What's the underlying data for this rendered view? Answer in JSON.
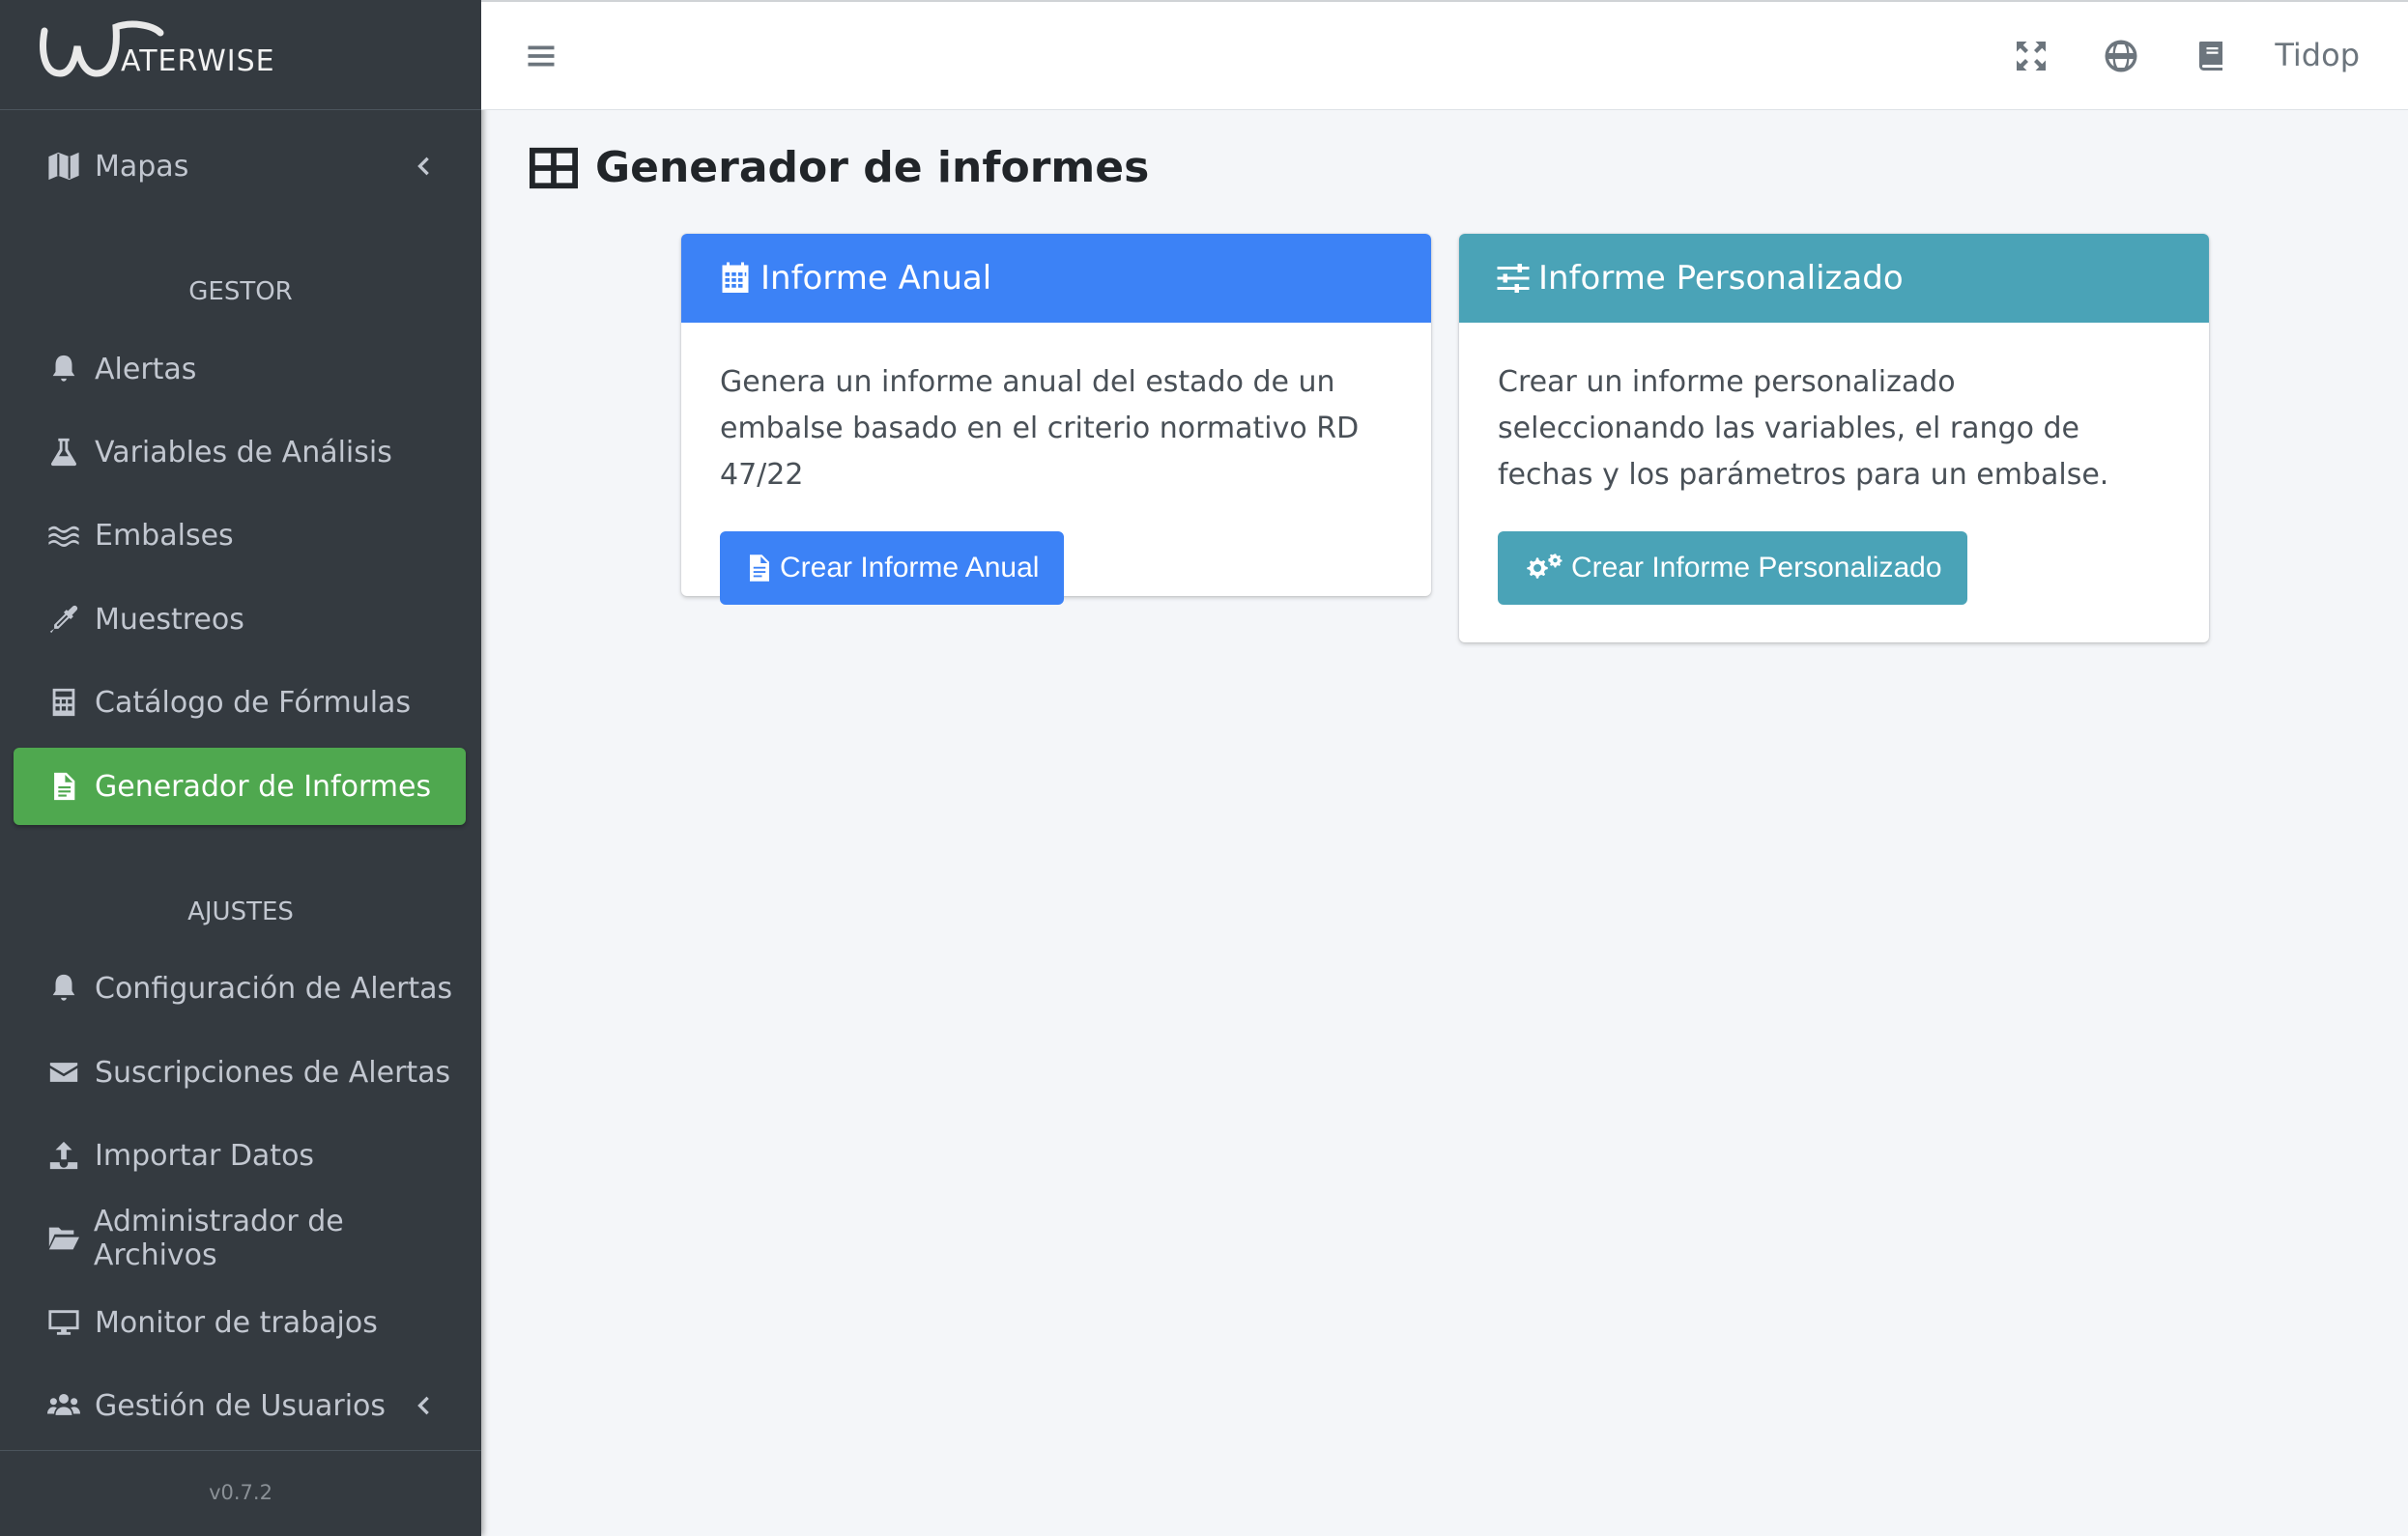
{
  "brand": {
    "logo_text": "ATERWISE"
  },
  "sidebar": {
    "items_top": [
      {
        "label": "Mapas",
        "icon": "map-icon",
        "has_chevron": true
      }
    ],
    "gestor_header": "GESTOR",
    "gestor_items": [
      {
        "label": "Alertas",
        "icon": "bell-icon"
      },
      {
        "label": "Variables de Análisis",
        "icon": "flask-icon"
      },
      {
        "label": "Embalses",
        "icon": "water-icon"
      },
      {
        "label": "Muestreos",
        "icon": "eyedropper-icon"
      },
      {
        "label": "Catálogo de Fórmulas",
        "icon": "calculator-icon"
      },
      {
        "label": "Generador de Informes",
        "icon": "file-icon",
        "active": true
      }
    ],
    "ajustes_header": "AJUSTES",
    "ajustes_items": [
      {
        "label": "Configuración de Alertas",
        "icon": "bell-icon"
      },
      {
        "label": "Suscripciones de Alertas",
        "icon": "envelope-icon"
      },
      {
        "label": "Importar Datos",
        "icon": "upload-icon"
      },
      {
        "label": "Administrador de Archivos",
        "icon": "folder-open-icon"
      },
      {
        "label": "Monitor de trabajos",
        "icon": "desktop-icon"
      },
      {
        "label": "Gestión de Usuarios",
        "icon": "users-icon",
        "has_chevron": true
      }
    ],
    "version": "v0.7.2"
  },
  "topbar": {
    "menu_icon": "hamburger-icon",
    "icons": [
      "expand-icon",
      "globe-icon",
      "book-icon"
    ],
    "user": "Tidop"
  },
  "main": {
    "title": "Generador de informes",
    "title_icon": "table-icon",
    "cards": [
      {
        "header": "Informe Anual",
        "header_icon": "calendar-icon",
        "header_color": "#3c82f6",
        "text": "Genera un informe anual del estado de un embalse basado en el criterio normativo RD 47/22",
        "button_label": "Crear Informe Anual",
        "button_icon": "file-text-icon",
        "button_color": "#3c82f6"
      },
      {
        "header": "Informe Personalizado",
        "header_icon": "sliders-icon",
        "header_color": "#4aa3b7",
        "text": "Crear un informe personalizado seleccionando las variables, el rango de fechas y los parámetros para un embalse.",
        "button_label": "Crear Informe Personalizado",
        "button_icon": "cogs-icon",
        "button_color": "#4aa3b7"
      }
    ]
  }
}
